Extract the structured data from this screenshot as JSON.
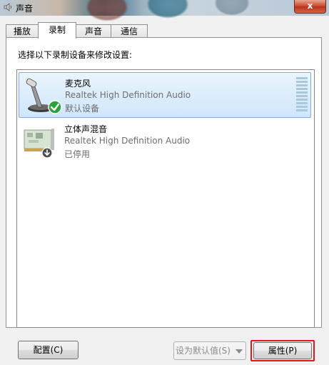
{
  "window": {
    "title": "声音",
    "close_label": "x"
  },
  "tabs": [
    {
      "label": "播放",
      "active": false
    },
    {
      "label": "录制",
      "active": true
    },
    {
      "label": "声音",
      "active": false
    },
    {
      "label": "通信",
      "active": false
    }
  ],
  "instruction": "选择以下录制设备来修改设置:",
  "devices": [
    {
      "name": "麦克风",
      "driver": "Realtek High Definition Audio",
      "status": "默认设备",
      "selected": true,
      "icon": "microphone-icon",
      "badge": "default-check-icon"
    },
    {
      "name": "立体声混音",
      "driver": "Realtek High Definition Audio",
      "status": "已停用",
      "selected": false,
      "icon": "sound-card-icon",
      "badge": "disabled-arrow-icon"
    }
  ],
  "buttons": {
    "configure": "配置(C)",
    "set_default": "设为默认值(S)",
    "properties": "属性(P)"
  },
  "colors": {
    "selection_border": "#84acdd",
    "highlight": "#e4141c",
    "check_green": "#2aa33a"
  }
}
